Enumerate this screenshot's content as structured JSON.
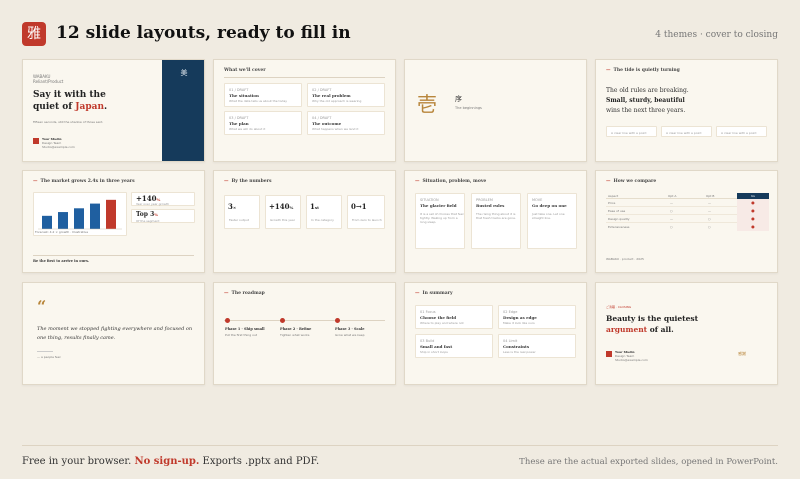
{
  "header": {
    "logo_glyph": "雅",
    "title": "12 slide layouts, ready to fill in",
    "meta": "4 themes · cover to closing"
  },
  "slides": {
    "s1": {
      "eyebrow": "WABAKU",
      "eyebrow2": "Reliant/Product",
      "line1": "Say it with the",
      "line2a": "quiet of ",
      "line2b": "Japan",
      "line2c": ".",
      "tagline": "Fifteen seconds, still the shadow of those sent.",
      "author": "Your Studio",
      "author2": "Design Team",
      "author3": "Studio@example.com",
      "panel_glyph": "美"
    },
    "s2": {
      "heading": "What we'll cover",
      "items": [
        {
          "num": "01 / DRAFT",
          "title": "The situation",
          "desc": "What the data tells us about the today"
        },
        {
          "num": "02 / DRAFT",
          "title": "The real problem",
          "desc": "Why the old approach is wearing"
        },
        {
          "num": "03 / DRAFT",
          "title": "The plan",
          "desc": "What we will do about it"
        },
        {
          "num": "04 / DRAFT",
          "title": "The outcome",
          "desc": "What happens when we land it"
        }
      ]
    },
    "s3": {
      "glyph": "壱",
      "label": "序",
      "sub": "The beginnings"
    },
    "s4": {
      "heading": "The tide is quietly turning",
      "line1": "The old rules are breaking.",
      "line2": "Small, sturdy, beautiful",
      "line3": "wins the next three years.",
      "chips": [
        "A clear line with a point",
        "A clear line with a point",
        "A clear line with a point"
      ]
    },
    "s5": {
      "heading": "The market grows 2.4x in three years",
      "stat1": "+140",
      "stat1b": "%",
      "stat1_desc": "Year over year growth",
      "stat2": "Top 3",
      "stat2b": "%",
      "stat2_desc": "Of the segment",
      "caption": "Forecast: 4.2 × growth · Illustrative",
      "footer": "Be the first to arrive in ours."
    },
    "s6": {
      "heading": "By the numbers",
      "items": [
        {
          "value": "3",
          "unit": "×",
          "desc": "Faster output"
        },
        {
          "value": "+140",
          "unit": "%",
          "desc": "Growth this year"
        },
        {
          "value": "1",
          "unit": "st",
          "desc": "In the category"
        },
        {
          "value": "0→1",
          "unit": "",
          "desc": "From zero to launch"
        }
      ]
    },
    "s7": {
      "heading": "Situation, problem, move",
      "cols": [
        {
          "label": "SITUATION",
          "title": "The glacier field",
          "desc": "It is a set of choices that feel tightly. Waking up from a long sleep."
        },
        {
          "label": "PROBLEM",
          "title": "Rusted rules",
          "desc": "The rising thing about it is that fresh tracks are gone."
        },
        {
          "label": "MOVE",
          "title": "Go deep on one",
          "desc": "Just take one. Let one straight line."
        }
      ]
    },
    "s8": {
      "heading": "How we compare",
      "cols": [
        "Aspect",
        "Opt A",
        "Opt B",
        "Us"
      ],
      "rows": [
        [
          "Price",
          "—",
          "—",
          "●"
        ],
        [
          "Ease of use",
          "○",
          "—",
          "●"
        ],
        [
          "Design quality",
          "—",
          "○",
          "●"
        ],
        [
          "Extensiveness",
          "○",
          "○",
          "●"
        ]
      ],
      "footer": "WABAKU · product · 2025"
    },
    "s9": {
      "quote_mark": "“",
      "quote": "The moment we stopped fighting everywhere and focused on one thing, results finally came.",
      "attribution": "— a people feel"
    },
    "s10": {
      "heading": "The roadmap",
      "phases": [
        {
          "title": "Phase 1 · Ship small",
          "desc": "Put the first thing out"
        },
        {
          "title": "Phase 2 · Refine",
          "desc": "Tighten what works"
        },
        {
          "title": "Phase 3 · Scale",
          "desc": "Grow what we keep"
        }
      ]
    },
    "s11": {
      "heading": "In summary",
      "cards": [
        {
          "label": "01 Focus",
          "title": "Choose the field",
          "desc": "Where to play and where not"
        },
        {
          "label": "02 Edge",
          "title": "Design as edge",
          "desc": "Make it look like ours"
        },
        {
          "label": "03 Build",
          "title": "Small and fast",
          "desc": "Ship in short loops"
        },
        {
          "label": "04 Limit",
          "title": "Constraints",
          "desc": "Less is the real power"
        }
      ]
    },
    "s12": {
      "eyebrow": "ご清聴 · CLOSING",
      "line1": "Beauty is the quietest",
      "line2a": "argument",
      "line2b": " of all.",
      "author": "Your Studio",
      "author2": "Design Team",
      "author3": "Studio@example.com",
      "stamp": "感謝"
    }
  },
  "footer": {
    "left_a": "Free in your browser. ",
    "left_b": "No sign-up.",
    "left_c": " Exports .pptx and PDF.",
    "right": "These are the actual exported slides, opened in PowerPoint."
  },
  "colors": {
    "background": "#f0ebe1",
    "accent": "#c0392b",
    "navy": "#153a5b",
    "blue": "#1f5fa0"
  },
  "chart_data": {
    "type": "bar",
    "categories": [
      "",
      "",
      "",
      "",
      ""
    ],
    "values": [
      14,
      18,
      22,
      27,
      31
    ],
    "ylim": [
      0,
      34
    ],
    "highlight_index": 4,
    "grid": false
  }
}
